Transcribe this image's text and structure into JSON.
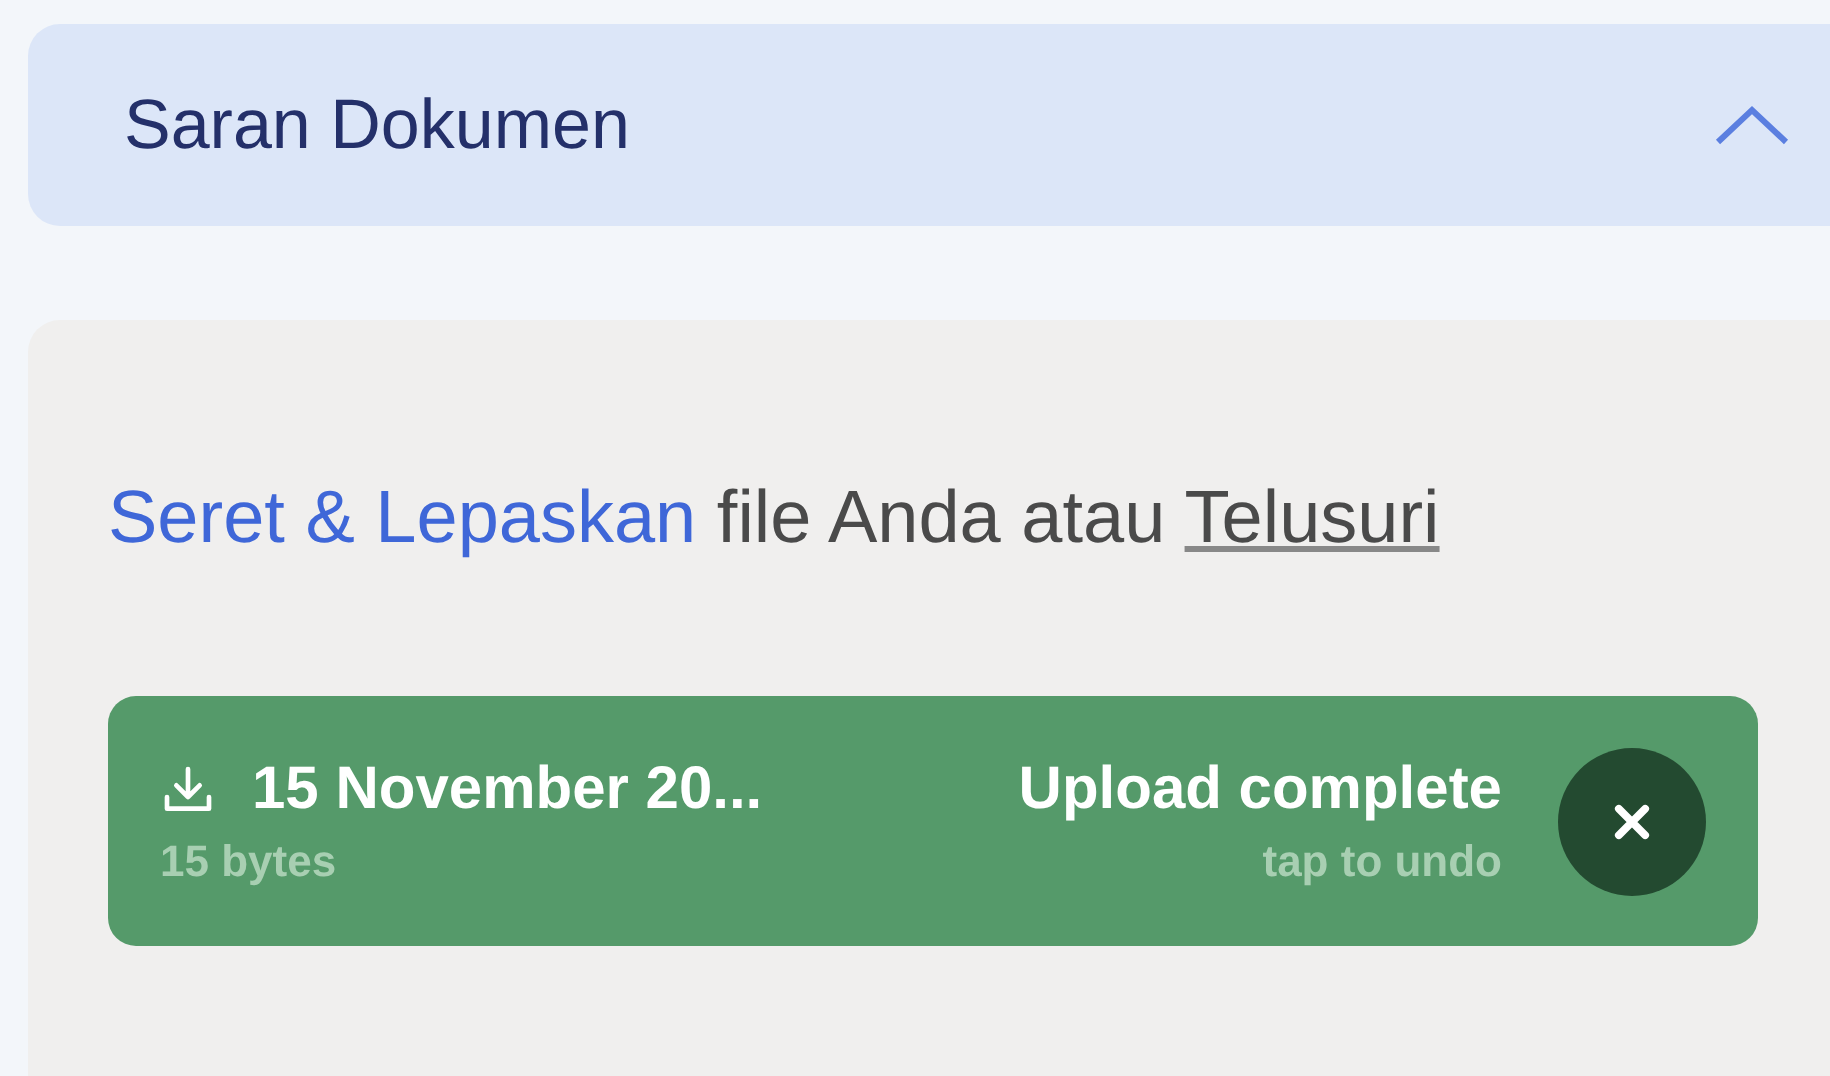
{
  "section": {
    "title": "Saran Dokumen",
    "expanded": true
  },
  "drop_zone": {
    "lead": "Seret & Lepaskan",
    "text": "file Anda atau",
    "link": "Telusuri"
  },
  "files": [
    {
      "name": "15 November 20...",
      "size": "15 bytes",
      "status": "Upload complete",
      "hint": "tap to undo"
    }
  ]
}
